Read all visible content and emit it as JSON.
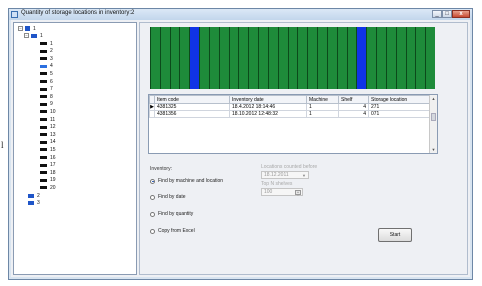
{
  "window": {
    "title": "Quantity of storage locations in inventory:2"
  },
  "tree": {
    "root_label": "1",
    "group_label": "1",
    "children": [
      "1",
      "2",
      "3",
      "4",
      "5",
      "6",
      "7",
      "8",
      "9",
      "10",
      "11",
      "12",
      "13",
      "14",
      "15",
      "16",
      "17",
      "18",
      "19",
      "20"
    ],
    "selected_index": 3,
    "siblings": [
      "2",
      "3"
    ]
  },
  "shelves": {
    "slot_count": 29,
    "free_slots": [
      4,
      21
    ],
    "colors": {
      "occupied": "#1e8b3a",
      "free": "#1033e6"
    }
  },
  "grid": {
    "columns": [
      "Item code",
      "Inventory date",
      "Machine",
      "Shelf",
      "Storage location"
    ],
    "rows": [
      {
        "marker": "▶",
        "cells": [
          "4381325",
          "18.4.2012 18:14:46",
          "1",
          "4",
          "271"
        ]
      },
      {
        "marker": "",
        "cells": [
          "4381356",
          "18.10.2012 12:48:32",
          "1",
          "4",
          "071"
        ]
      }
    ]
  },
  "inventory": {
    "label": "Inventory:",
    "options": [
      {
        "label": "Find by machine and location",
        "selected": true
      },
      {
        "label": "Find by date",
        "selected": false
      },
      {
        "label": "Find by quantity",
        "selected": false
      },
      {
        "label": "Copy from Excel",
        "selected": false
      }
    ]
  },
  "filters": {
    "date_label": "Locations counted before",
    "date_value": "18.12.2011",
    "top_label": "Top N shelves",
    "top_value": "100"
  },
  "start_button": "Start",
  "side_letter": "l"
}
